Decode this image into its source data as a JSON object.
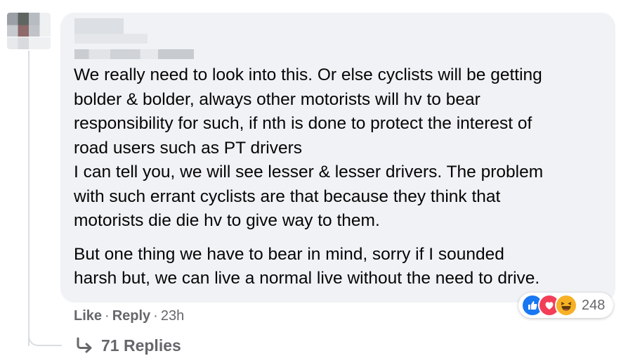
{
  "comment": {
    "author_name": "",
    "paragraphs": [
      "We really need to look into this. Or else cyclists will be getting\nbolder & bolder, always other motorists will hv to bear\nresponsibility for such, if nth is done to protect the interest of\nroad users such as PT drivers\nI can tell you, we will see lesser & lesser drivers. The problem\nwith such errant cyclists are that because they think that\nmotorists die die hv to give way to them.",
      "But one thing we have to bear in mind, sorry if I sounded\nharsh but, we can live a normal live without the need to drive."
    ],
    "actions": {
      "like_label": "Like",
      "separator": "·",
      "reply_label": "Reply",
      "timestamp": "23h"
    },
    "reactions": {
      "icons": [
        "like-icon",
        "love-icon",
        "haha-icon"
      ],
      "count": "248",
      "colors": {
        "like": "#1877f2",
        "love": "#f33e58",
        "haha": "#f7b125"
      }
    },
    "replies_label": "71 Replies"
  }
}
